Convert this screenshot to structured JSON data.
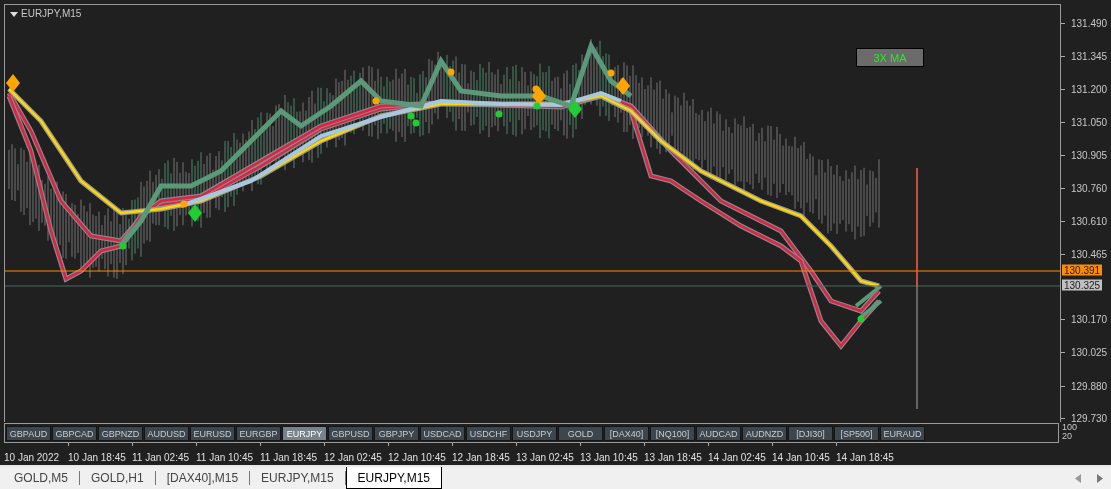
{
  "chart": {
    "title": "EURJPY,M15",
    "indicator_label": "3X MA"
  },
  "price_axis": {
    "ticks": [
      "131.490",
      "131.345",
      "131.200",
      "131.050",
      "130.905",
      "130.760",
      "130.610",
      "130.465",
      "130.170",
      "130.025",
      "129.880",
      "129.730"
    ],
    "bid_tag": "130.391",
    "ask_tag": "130.325"
  },
  "symbol_buttons": [
    {
      "label": "GBPAUD",
      "selected": false
    },
    {
      "label": "GBPCAD",
      "selected": false
    },
    {
      "label": "GBPNZD",
      "selected": false
    },
    {
      "label": "AUDUSD",
      "selected": false
    },
    {
      "label": "EURUSD",
      "selected": false
    },
    {
      "label": "EURGBP",
      "selected": false
    },
    {
      "label": "EURJPY",
      "selected": true
    },
    {
      "label": "GBPUSD",
      "selected": false
    },
    {
      "label": "GBPJPY",
      "selected": false
    },
    {
      "label": "USDCAD",
      "selected": false
    },
    {
      "label": "USDCHF",
      "selected": false
    },
    {
      "label": "USDJPY",
      "selected": false
    },
    {
      "label": "GOLD",
      "selected": false
    },
    {
      "label": "[DAX40]",
      "selected": false
    },
    {
      "label": "[NQ100]",
      "selected": false
    },
    {
      "label": "AUDCAD",
      "selected": false
    },
    {
      "label": "AUDNZD",
      "selected": false
    },
    {
      "label": "[DJI30]",
      "selected": false
    },
    {
      "label": "[SP500]",
      "selected": false
    },
    {
      "label": "EURAUD",
      "selected": false
    }
  ],
  "subwindow_axis": [
    "100",
    "20"
  ],
  "time_axis": [
    "10 Jan 2022",
    "10 Jan 18:45",
    "11 Jan 02:45",
    "11 Jan 10:45",
    "11 Jan 18:45",
    "12 Jan 02:45",
    "12 Jan 10:45",
    "12 Jan 18:45",
    "13 Jan 02:45",
    "13 Jan 10:45",
    "13 Jan 18:45",
    "14 Jan 02:45",
    "14 Jan 10:45",
    "14 Jan 18:45"
  ],
  "tabs": [
    {
      "label": "GOLD,M5",
      "selected": false
    },
    {
      "label": "GOLD,H1",
      "selected": false
    },
    {
      "label": "[DAX40],M15",
      "selected": false
    },
    {
      "label": "EURJPY,M15",
      "selected": false
    },
    {
      "label": "EURJPY,M15",
      "selected": true
    }
  ]
}
